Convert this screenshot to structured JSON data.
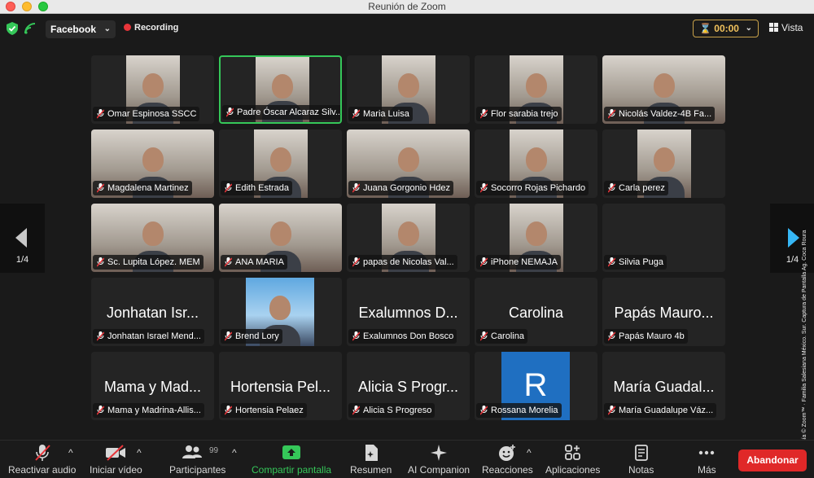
{
  "window": {
    "title": "Reunión de Zoom"
  },
  "topbar": {
    "stream_target": "Facebook",
    "recording_label": "Recording",
    "timer": "00:00",
    "view_label": "Vista"
  },
  "pagination": {
    "prev_page": "1/4",
    "next_page": "1/4"
  },
  "credit": "Cortesía © Zoom™ · Familia Salesiana México. Sur. Captura de Pantalla Ag. Coca Roura",
  "tiles": [
    {
      "name": "Omar Espinosa SSCC",
      "big": "",
      "video": true
    },
    {
      "name": "Padre Óscar Alcaraz Silv...",
      "big": "",
      "video": true,
      "active": true
    },
    {
      "name": "Maria Luisa",
      "big": "",
      "video": true
    },
    {
      "name": "Flor sarabia trejo",
      "big": "",
      "video": true
    },
    {
      "name": "Nicolás Valdez-4B Fa...",
      "big": "",
      "video": true
    },
    {
      "name": "Magdalena Martinez",
      "big": "",
      "video": true
    },
    {
      "name": "Edith Estrada",
      "big": "",
      "video": true
    },
    {
      "name": "Juana Gorgonio Hdez",
      "big": "",
      "video": true
    },
    {
      "name": "Socorro Rojas Pichardo",
      "big": "",
      "video": true
    },
    {
      "name": "Carla perez",
      "big": "",
      "video": true
    },
    {
      "name": "Sc. Lupita López. MEM",
      "big": "",
      "video": true
    },
    {
      "name": "ANA MARIA",
      "big": "",
      "video": true
    },
    {
      "name": "papas de Nicolas Val...",
      "big": "",
      "video": true
    },
    {
      "name": "iPhone NEMAJA",
      "big": "",
      "video": true
    },
    {
      "name": "Silvia Puga",
      "big": "",
      "video": false
    },
    {
      "name": "Jonhatan Israel Mend...",
      "big": "Jonhatan Isr...",
      "video": false
    },
    {
      "name": "Brend Lory",
      "big": "",
      "video": true
    },
    {
      "name": "Exalumnos Don Bosco",
      "big": "Exalumnos D...",
      "video": false
    },
    {
      "name": "Carolina",
      "big": "Carolina",
      "video": false
    },
    {
      "name": "Papás Mauro 4b",
      "big": "Papás Mauro...",
      "video": false
    },
    {
      "name": "Mama y Madrina-Allis...",
      "big": "Mama y Mad...",
      "video": false
    },
    {
      "name": "Hortensia Pelaez",
      "big": "Hortensia Pel...",
      "video": false
    },
    {
      "name": "Alicia S Progreso",
      "big": "Alicia S Progr...",
      "video": false
    },
    {
      "name": "Rossana Morelia",
      "big": "",
      "video": false,
      "avatar_letter": "R"
    },
    {
      "name": "María Guadalupe Váz...",
      "big": "María Guadal...",
      "video": false
    }
  ],
  "toolbar": {
    "audio": "Reactivar audio",
    "video": "Iniciar vídeo",
    "participants": "Participantes",
    "participants_count": "99",
    "share": "Compartir pantalla",
    "summary": "Resumen",
    "companion": "AI Companion",
    "reactions": "Reacciones",
    "apps": "Aplicaciones",
    "notes": "Notas",
    "more": "Más",
    "leave": "Abandonar"
  },
  "colors": {
    "share_green": "#35c759",
    "leave_red": "#e02828",
    "recording_red": "#e8353a",
    "timer_gold": "#f0c15c",
    "active_speaker": "#35c759"
  }
}
